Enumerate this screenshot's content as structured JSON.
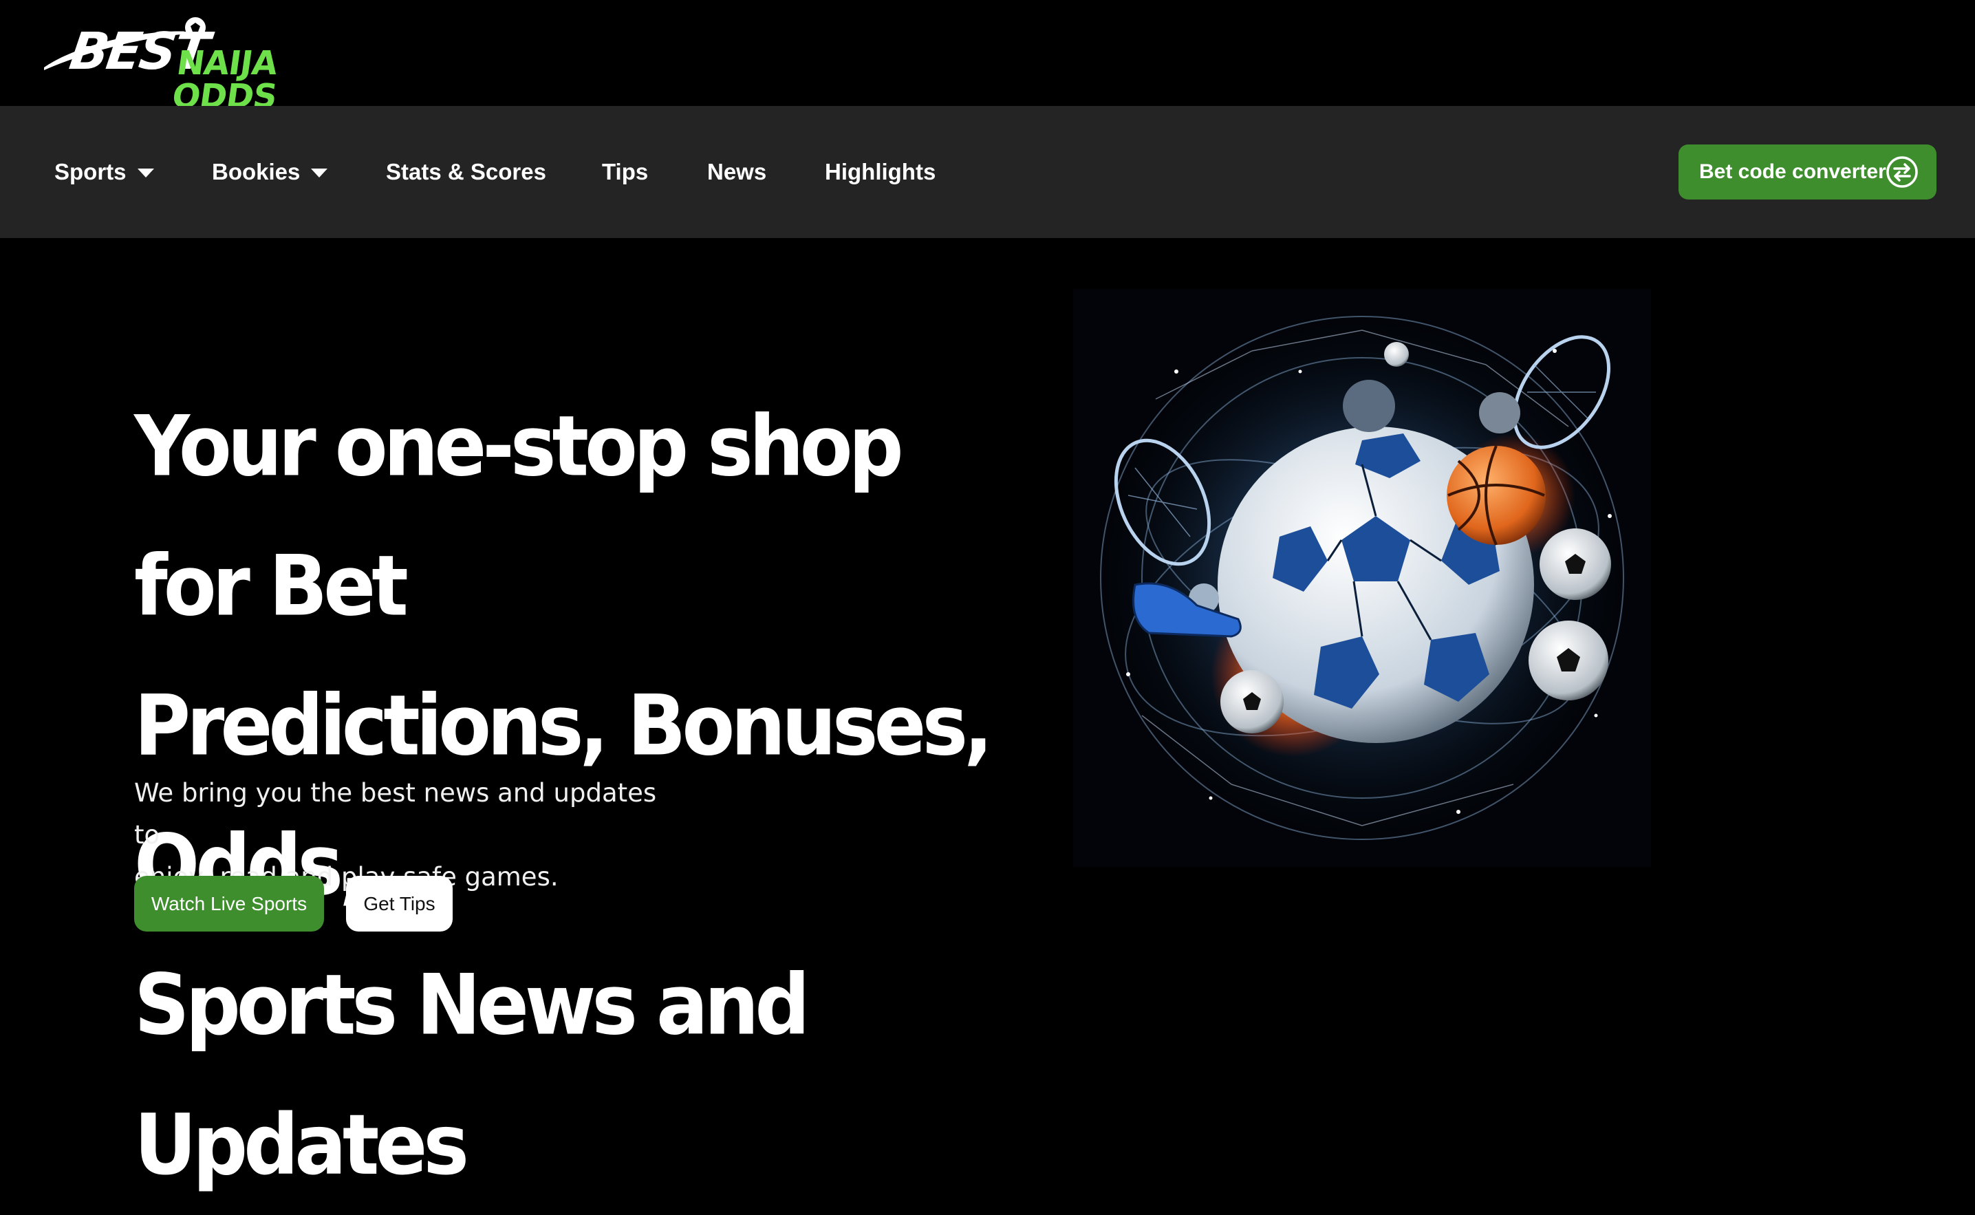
{
  "logo": {
    "best": "BEST",
    "naija_odds": "NAIJA ODDS"
  },
  "nav": {
    "items": [
      {
        "label": "Sports",
        "dropdown": true
      },
      {
        "label": "Bookies",
        "dropdown": true
      },
      {
        "label": "Stats & Scores",
        "dropdown": false
      },
      {
        "label": "Tips",
        "dropdown": false
      },
      {
        "label": "News",
        "dropdown": false
      },
      {
        "label": "Highlights",
        "dropdown": false
      }
    ],
    "converter_label": "Bet code converter",
    "converter_icon": "swap-arrows-icon"
  },
  "hero": {
    "title_lines": [
      "Your one-stop shop for Bet",
      "Predictions, Bonuses, Odds,",
      "Sports News and Updates"
    ],
    "subtitle_lines": [
      "We bring you the best news and updates to",
      "enjoy, read and play safe games."
    ],
    "primary_button": "Watch Live Sports",
    "secondary_button": "Get Tips",
    "image": "sports-balls-collage"
  },
  "colors": {
    "accent_green": "#3e8e2e",
    "logo_green": "#6de04a",
    "navbar_bg": "#242424",
    "page_bg": "#000000"
  }
}
